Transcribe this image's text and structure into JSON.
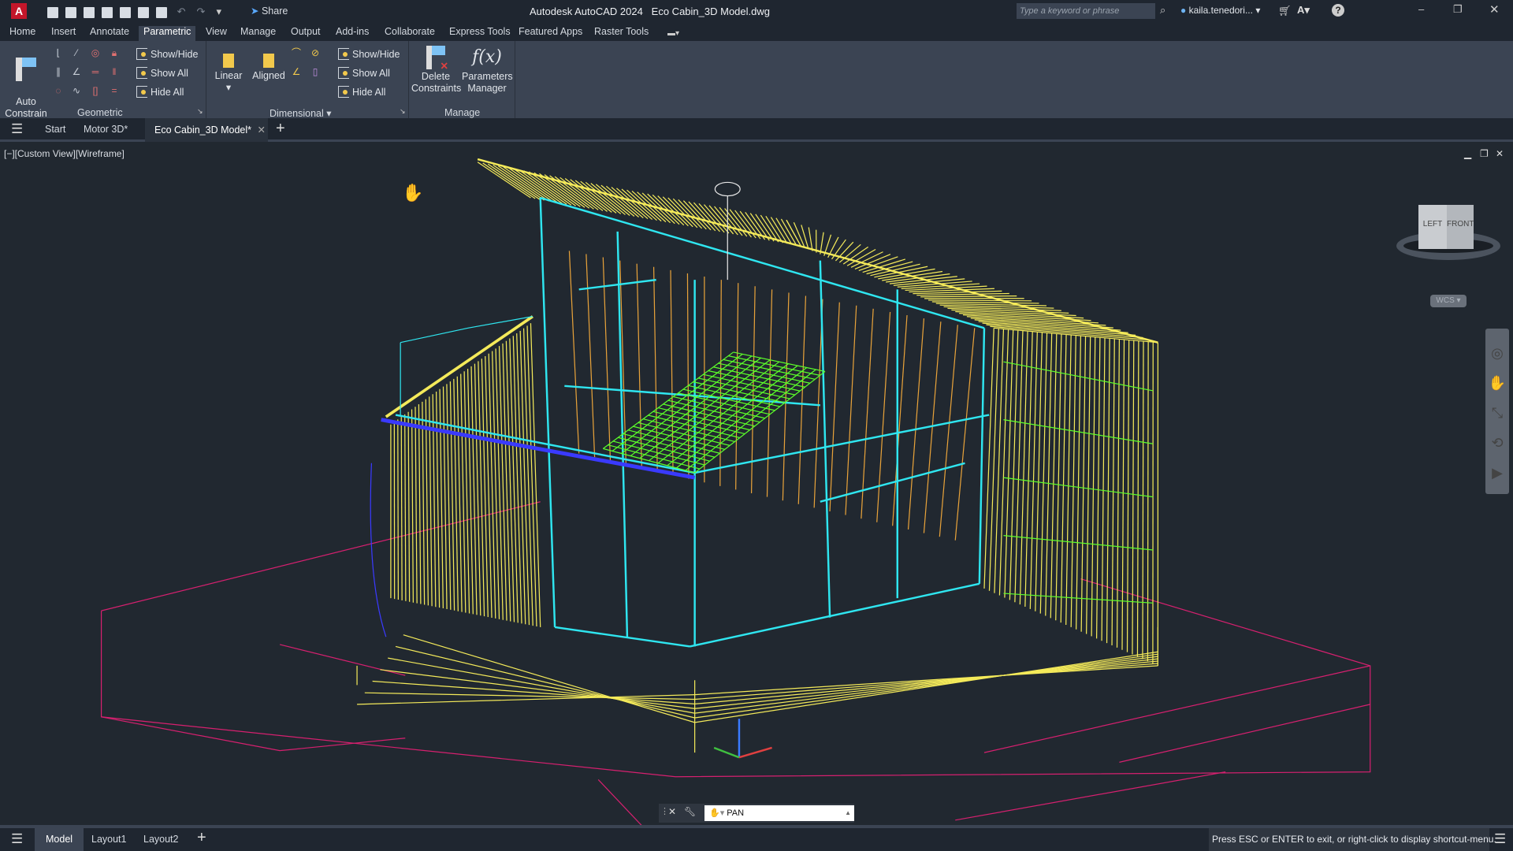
{
  "titlebar": {
    "app_title": "Autodesk AutoCAD 2024",
    "file_title": "Eco Cabin_3D Model.dwg",
    "share_label": "Share",
    "search_placeholder": "Type a keyword or phrase",
    "user": "kaila.tenedori...",
    "app_letter": "A"
  },
  "ribbon_tabs": [
    {
      "label": "Home"
    },
    {
      "label": "Insert"
    },
    {
      "label": "Annotate"
    },
    {
      "label": "Parametric",
      "active": true
    },
    {
      "label": "View"
    },
    {
      "label": "Manage"
    },
    {
      "label": "Output"
    },
    {
      "label": "Add-ins"
    },
    {
      "label": "Collaborate"
    },
    {
      "label": "Express Tools"
    },
    {
      "label": "Featured Apps"
    },
    {
      "label": "Raster Tools"
    }
  ],
  "ribbon": {
    "geometric": {
      "panel_label": "Geometric",
      "auto_constrain": "Auto\nConstrain",
      "show_hide": "Show/Hide",
      "show_all": "Show All",
      "hide_all": "Hide All"
    },
    "dimensional": {
      "panel_label": "Dimensional",
      "linear": "Linear",
      "aligned": "Aligned",
      "show_hide": "Show/Hide",
      "show_all": "Show All",
      "hide_all": "Hide All"
    },
    "manage": {
      "panel_label": "Manage",
      "delete_constraints": "Delete\nConstraints",
      "parameters_manager": "Parameters\nManager",
      "fx": "f(x)"
    }
  },
  "doc_tabs": [
    {
      "label": "Start"
    },
    {
      "label": "Motor 3D*"
    },
    {
      "label": "Eco Cabin_3D Model*",
      "active": true
    }
  ],
  "viewport": {
    "label": "[−][Custom View][Wireframe]",
    "viewcube": {
      "left": "LEFT",
      "front": "FRONT",
      "ucs": "WCS"
    }
  },
  "command_line": {
    "value": "PAN"
  },
  "layout_tabs": [
    {
      "label": "Model",
      "active": true
    },
    {
      "label": "Layout1"
    },
    {
      "label": "Layout2"
    }
  ],
  "status": {
    "message": "Press ESC or ENTER to exit, or right-click to display shortcut-menu."
  },
  "colors": {
    "background": "#212830",
    "ribbon": "#3b4453",
    "cyan": "#2fe6f0",
    "yellow": "#f4ea5a",
    "green": "#5cff2a",
    "magenta": "#d6206f",
    "orange": "#e7a23a",
    "blue": "#3a3aff"
  }
}
